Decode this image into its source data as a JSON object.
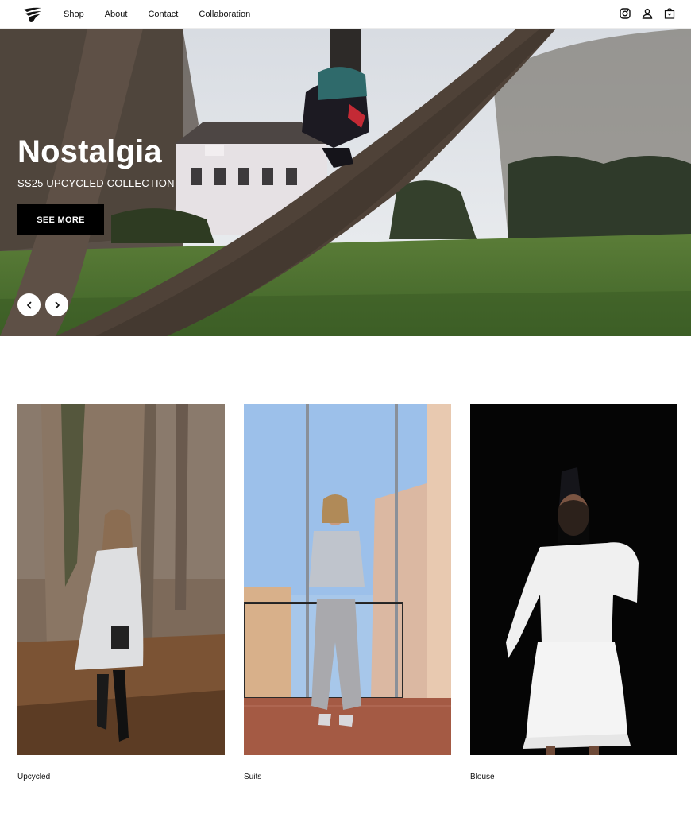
{
  "header": {
    "logo_icon": "brand-logo-icon",
    "nav": [
      {
        "label": "Shop"
      },
      {
        "label": "About"
      },
      {
        "label": "Contact"
      },
      {
        "label": "Collaboration"
      }
    ],
    "icons": [
      "instagram-icon",
      "user-icon",
      "shopping-bag-icon"
    ]
  },
  "hero": {
    "title": "Nostalgia",
    "subtitle": "SS25 UPCYCLED COLLECTION",
    "button_label": "SEE MORE",
    "prev_icon": "chevron-left-icon",
    "next_icon": "chevron-right-icon"
  },
  "products": [
    {
      "label": "Upcycled"
    },
    {
      "label": "Suits"
    },
    {
      "label": "Blouse"
    }
  ],
  "colors": {
    "button_bg": "#000000",
    "hero_text": "#ffffff",
    "grass": "#4f7a34",
    "sky": "#e3e6ea"
  }
}
